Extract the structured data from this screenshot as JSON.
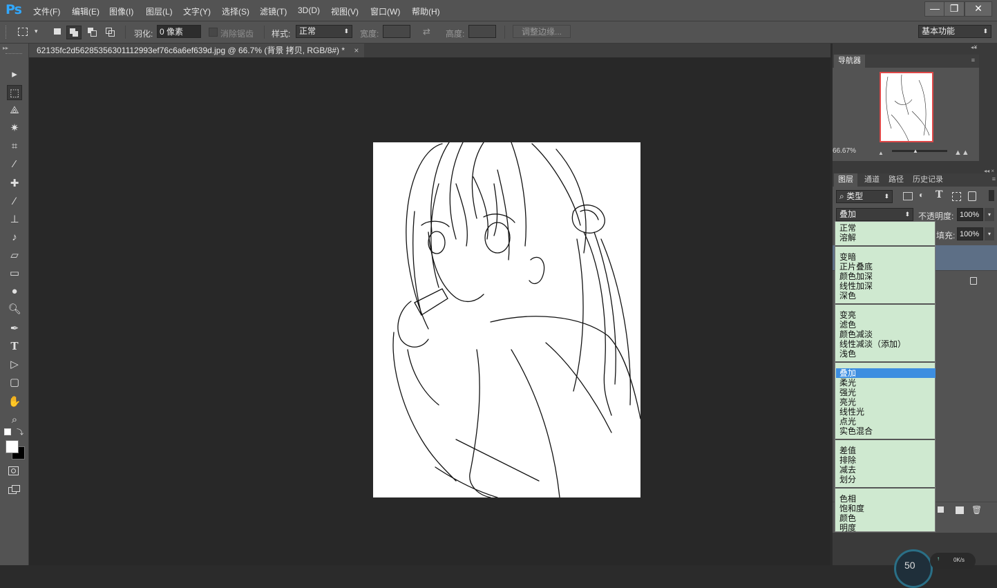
{
  "app": {
    "logo": "Ps"
  },
  "menu": [
    "文件(F)",
    "编辑(E)",
    "图像(I)",
    "图层(L)",
    "文字(Y)",
    "选择(S)",
    "滤镜(T)",
    "3D(D)",
    "视图(V)",
    "窗口(W)",
    "帮助(H)"
  ],
  "window_controls": {
    "minimize": "—",
    "restore": "❐",
    "close": "✕"
  },
  "options": {
    "feather_label": "羽化:",
    "feather_value": "0 像素",
    "antialias_label": "消除锯齿",
    "style_label": "样式:",
    "style_value": "正常",
    "width_label": "宽度:",
    "height_label": "高度:",
    "refine_edge_button": "调整边缘...",
    "workspace": "基本功能"
  },
  "document_tab": {
    "title": "62135fc2d56285356301112993ef76c6a6ef639d.jpg @ 66.7% (背景 拷贝, RGB/8#) *",
    "close": "×"
  },
  "navigator": {
    "tab": "导航器",
    "zoom": "66.67%"
  },
  "layers_panel": {
    "tabs": [
      "图层",
      "通道",
      "路径",
      "历史记录"
    ],
    "filter_kind": "类型",
    "blend_mode": "叠加",
    "opacity_label": "不透明度:",
    "opacity_value": "100%",
    "fill_label": "填充:",
    "fill_value": "100%"
  },
  "blend_menu": {
    "groups": [
      [
        "正常",
        "溶解"
      ],
      [
        "变暗",
        "正片叠底",
        "颜色加深",
        "线性加深",
        "深色"
      ],
      [
        "变亮",
        "滤色",
        "颜色减淡",
        "线性减淡（添加）",
        "浅色"
      ],
      [
        "叠加",
        "柔光",
        "强光",
        "亮光",
        "线性光",
        "点光",
        "实色混合"
      ],
      [
        "差值",
        "排除",
        "减去",
        "划分"
      ],
      [
        "色相",
        "饱和度",
        "颜色",
        "明度"
      ]
    ],
    "selected": "叠加"
  },
  "status_meter": {
    "value": "50",
    "rate": "0K/s"
  },
  "tools": [
    "move-tool",
    "marquee-tool",
    "lasso-tool",
    "magic-wand-tool",
    "crop-tool",
    "eyedropper-tool",
    "healing-brush-tool",
    "brush-tool",
    "clone-stamp-tool",
    "history-brush-tool",
    "eraser-tool",
    "gradient-tool",
    "blur-tool",
    "dodge-tool",
    "pen-tool",
    "type-tool",
    "path-selection-tool",
    "shape-tool",
    "hand-tool",
    "zoom-tool"
  ],
  "tool_glyphs": {
    "type-tool": "T"
  },
  "colors": {
    "accent": "#31a8ff",
    "menu_bg": "#cfe9d0",
    "selection": "#3d8ee0",
    "ui_bg": "#535353",
    "canvas_bg": "#282828"
  }
}
